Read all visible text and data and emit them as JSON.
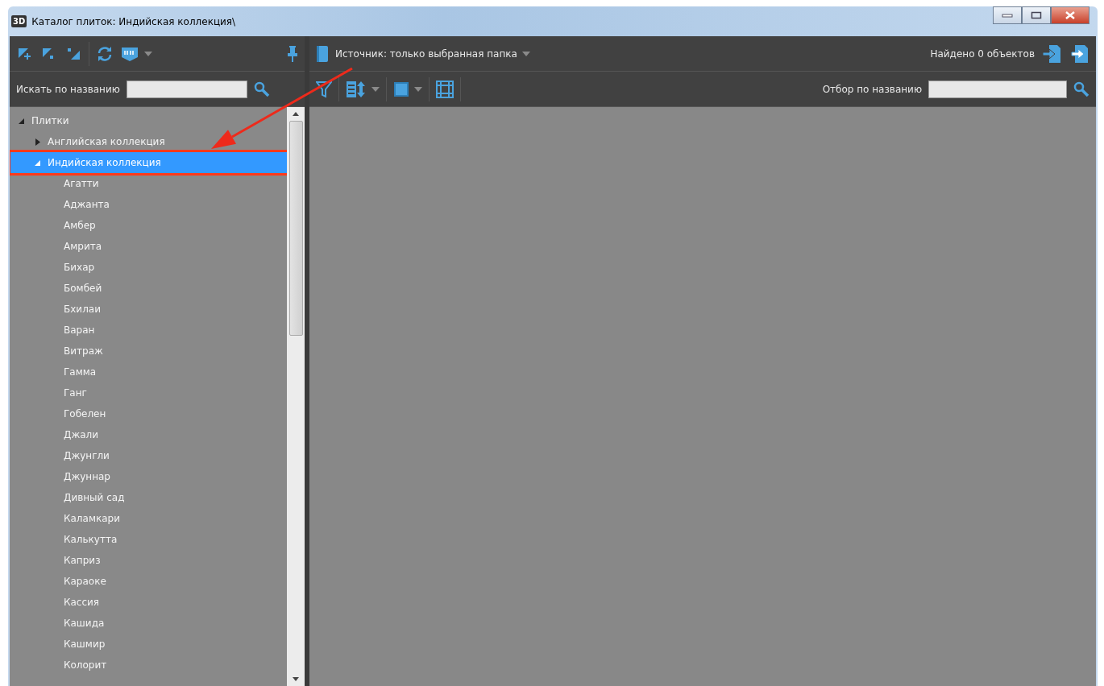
{
  "window": {
    "logo": "3D",
    "title": "Каталог плиток: Индийская коллекция\\"
  },
  "left_panel": {
    "search": {
      "label": "Искать по названию"
    }
  },
  "tree": [
    {
      "label": "Плитки",
      "expanded": true,
      "selected": false,
      "children": [
        {
          "label": "Английская коллекция",
          "expanded": false,
          "selected": false
        },
        {
          "label": "Индийская коллекция",
          "expanded": true,
          "selected": true,
          "children": [
            {
              "label": "Агатти",
              "selected": false
            },
            {
              "label": "Аджанта",
              "selected": false
            },
            {
              "label": "Амбер",
              "selected": false
            },
            {
              "label": "Амрита",
              "selected": false
            },
            {
              "label": "Бихар",
              "selected": false
            },
            {
              "label": "Бомбей",
              "selected": false
            },
            {
              "label": "Бхилаи",
              "selected": false
            },
            {
              "label": "Варан",
              "selected": false
            },
            {
              "label": "Витраж",
              "selected": false
            },
            {
              "label": "Гамма",
              "selected": false
            },
            {
              "label": "Ганг",
              "selected": false
            },
            {
              "label": "Гобелен",
              "selected": false
            },
            {
              "label": "Джали",
              "selected": false
            },
            {
              "label": "Джунгли",
              "selected": false
            },
            {
              "label": "Джуннар",
              "selected": false
            },
            {
              "label": "Дивный сад",
              "selected": false
            },
            {
              "label": "Каламкари",
              "selected": false
            },
            {
              "label": "Калькутта",
              "selected": false
            },
            {
              "label": "Каприз",
              "selected": false
            },
            {
              "label": "Караоке",
              "selected": false
            },
            {
              "label": "Кассия",
              "selected": false
            },
            {
              "label": "Кашида",
              "selected": false
            },
            {
              "label": "Кашмир",
              "selected": false
            },
            {
              "label": "Колорит",
              "selected": false
            }
          ]
        }
      ]
    }
  ],
  "right_panel": {
    "source": {
      "label": "Источник: только выбранная папка"
    },
    "found": "Найдено 0 объектов",
    "filter": {
      "label": "Отбор по названию"
    }
  }
}
